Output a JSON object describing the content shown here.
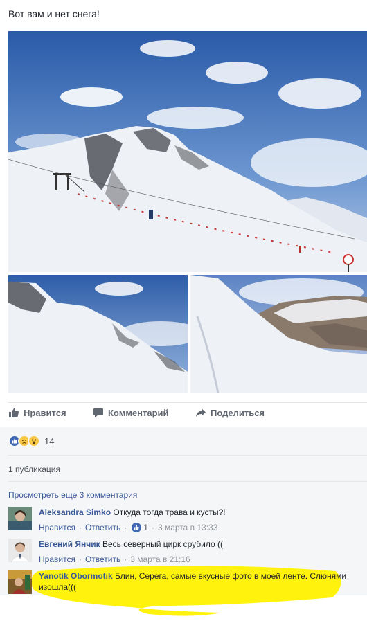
{
  "post": {
    "text": "Вот вам и нет снега!"
  },
  "actions": {
    "like": "Нравится",
    "comment": "Комментарий",
    "share": "Поделиться"
  },
  "reactions": {
    "types": [
      "like-icon",
      "sad-icon",
      "wow-icon"
    ],
    "count": "14"
  },
  "publications": "1 публикация",
  "more_comments": "Просмотреть еще 3 комментария",
  "comments": [
    {
      "author": "Aleksandra Simko",
      "text": "Откуда тогда трава и кусты?!",
      "like": "Нравится",
      "reply": "Ответить",
      "likes": "1",
      "time": "3 марта в 13:33"
    },
    {
      "author": "Евгений Янчик",
      "text": "Весь северный цирк срубило ((",
      "like": "Нравится",
      "reply": "Ответить",
      "time": "3 марта в 21:16"
    },
    {
      "author": "Yanotik Obormotik",
      "text": "Блин, Серега, самые вкусные фото в моей ленте. Слюнями изошла((("
    }
  ],
  "colors": {
    "link": "#385898",
    "highlight": "#fff200",
    "sky": "#3f6fb8",
    "snow": "#eef1f6"
  }
}
